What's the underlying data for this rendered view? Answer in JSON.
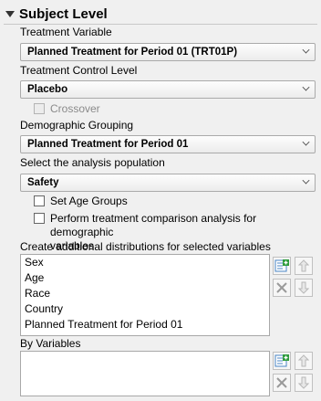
{
  "section": {
    "title": "Subject Level"
  },
  "treatment_variable": {
    "label": "Treatment Variable",
    "value": "Planned Treatment for Period 01 (TRT01P)"
  },
  "treatment_control": {
    "label": "Treatment Control Level",
    "value": "Placebo"
  },
  "crossover": {
    "label": "Crossover",
    "checked": false,
    "enabled": false
  },
  "demographic_grouping": {
    "label": "Demographic Grouping",
    "value": "Planned Treatment for Period 01"
  },
  "analysis_population": {
    "label": "Select the analysis population",
    "value": "Safety"
  },
  "set_age_groups": {
    "label": "Set Age Groups",
    "checked": false
  },
  "treatment_comparison": {
    "label_line1": "Perform treatment comparison analysis for demographic",
    "label_line2": "variables",
    "checked": false
  },
  "distributions": {
    "label": "Create additional distributions for selected variables",
    "items": [
      "Sex",
      "Age",
      "Race",
      "Country",
      "Planned Treatment for Period 01"
    ]
  },
  "by_variables": {
    "label": "By Variables",
    "items": []
  },
  "icons": {
    "add": "add-list-icon",
    "remove": "remove-x-icon",
    "up": "arrow-up-icon",
    "down": "arrow-down-icon"
  }
}
